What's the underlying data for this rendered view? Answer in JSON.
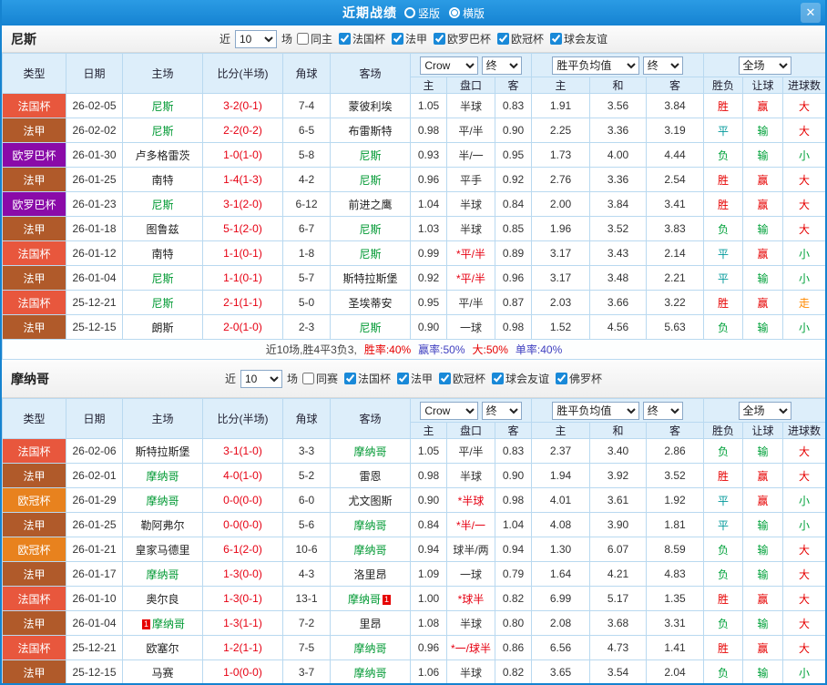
{
  "window": {
    "title": "近期战绩",
    "close_icon": "✕",
    "layout_options": [
      {
        "name": "vertical",
        "label": "竖版",
        "selected": false
      },
      {
        "name": "horizontal",
        "label": "横版",
        "selected": true
      }
    ]
  },
  "controls": {
    "near_label": "近",
    "match_count": "10",
    "games_label": "场",
    "bookmaker": "Crow",
    "final_label": "终",
    "avg_label": "胜平负均值",
    "scope_label": "全场"
  },
  "columns": {
    "type": "类型",
    "date": "日期",
    "home": "主场",
    "score": "比分(半场)",
    "corner": "角球",
    "away": "客场",
    "asian_home": "主",
    "asian_line": "盘口",
    "asian_away": "客",
    "avg_home": "主",
    "avg_draw": "和",
    "avg_away": "客",
    "wdl": "胜负",
    "handicap": "让球",
    "goals": "进球数"
  },
  "colors": {
    "accent_blue": "#1989d8",
    "focus_team_green": "#009933",
    "score_red": "#e60012",
    "types": {
      "法国杯": "#e8573d",
      "法甲": "#b05a2a",
      "欧罗巴杯": "#8a0ba8",
      "欧冠杯": "#e8821e"
    },
    "results": {
      "胜": "#e60000",
      "平": "#00999b",
      "负": "#00a13a",
      "赢": "#e60000",
      "输": "#00a13a",
      "大": "#e60000",
      "小": "#00a13a",
      "走": "#ff8a00"
    }
  },
  "sections": [
    {
      "team": "尼斯",
      "filters": [
        {
          "label": "同主",
          "checked": false
        },
        {
          "label": "法国杯",
          "checked": true
        },
        {
          "label": "法甲",
          "checked": true
        },
        {
          "label": "欧罗巴杯",
          "checked": true
        },
        {
          "label": "欧冠杯",
          "checked": true
        },
        {
          "label": "球会友谊",
          "checked": true
        }
      ],
      "rows": [
        {
          "type": "法国杯",
          "date": "26-02-05",
          "home": "尼斯",
          "home_focus": true,
          "score": "3-2(0-1)",
          "corner": "7-4",
          "away": "蒙彼利埃",
          "away_focus": false,
          "o1": "1.05",
          "line": "半球",
          "o2": "0.83",
          "e1": "1.91",
          "e2": "3.56",
          "e3": "3.84",
          "r1": "胜",
          "r2": "赢",
          "r3": "大"
        },
        {
          "type": "法甲",
          "date": "26-02-02",
          "home": "尼斯",
          "home_focus": true,
          "score": "2-2(0-2)",
          "corner": "6-5",
          "away": "布雷斯特",
          "away_focus": false,
          "o1": "0.98",
          "line": "平/半",
          "o2": "0.90",
          "e1": "2.25",
          "e2": "3.36",
          "e3": "3.19",
          "r1": "平",
          "r2": "输",
          "r3": "大"
        },
        {
          "type": "欧罗巴杯",
          "date": "26-01-30",
          "home": "卢多格雷茨",
          "home_focus": false,
          "score": "1-0(1-0)",
          "corner": "5-8",
          "away": "尼斯",
          "away_focus": true,
          "o1": "0.93",
          "line": "半/一",
          "o2": "0.95",
          "e1": "1.73",
          "e2": "4.00",
          "e3": "4.44",
          "r1": "负",
          "r2": "输",
          "r3": "小"
        },
        {
          "type": "法甲",
          "date": "26-01-25",
          "home": "南特",
          "home_focus": false,
          "score": "1-4(1-3)",
          "corner": "4-2",
          "away": "尼斯",
          "away_focus": true,
          "o1": "0.96",
          "line": "平手",
          "o2": "0.92",
          "e1": "2.76",
          "e2": "3.36",
          "e3": "2.54",
          "r1": "胜",
          "r2": "赢",
          "r3": "大"
        },
        {
          "type": "欧罗巴杯",
          "date": "26-01-23",
          "home": "尼斯",
          "home_focus": true,
          "score": "3-1(2-0)",
          "corner": "6-12",
          "away": "前进之鹰",
          "away_focus": false,
          "o1": "1.04",
          "line": "半球",
          "o2": "0.84",
          "e1": "2.00",
          "e2": "3.84",
          "e3": "3.41",
          "r1": "胜",
          "r2": "赢",
          "r3": "大"
        },
        {
          "type": "法甲",
          "date": "26-01-18",
          "home": "图鲁兹",
          "home_focus": false,
          "score": "5-1(2-0)",
          "corner": "6-7",
          "away": "尼斯",
          "away_focus": true,
          "o1": "1.03",
          "line": "半球",
          "o2": "0.85",
          "e1": "1.96",
          "e2": "3.52",
          "e3": "3.83",
          "r1": "负",
          "r2": "输",
          "r3": "大"
        },
        {
          "type": "法国杯",
          "date": "26-01-12",
          "home": "南特",
          "home_focus": false,
          "score": "1-1(0-1)",
          "corner": "1-8",
          "away": "尼斯",
          "away_focus": true,
          "o1": "0.99",
          "line": "*平/半",
          "o2": "0.89",
          "e1": "3.17",
          "e2": "3.43",
          "e3": "2.14",
          "r1": "平",
          "r2": "赢",
          "r3": "小"
        },
        {
          "type": "法甲",
          "date": "26-01-04",
          "home": "尼斯",
          "home_focus": true,
          "score": "1-1(0-1)",
          "corner": "5-7",
          "away": "斯特拉斯堡",
          "away_focus": false,
          "o1": "0.92",
          "line": "*平/半",
          "o2": "0.96",
          "e1": "3.17",
          "e2": "3.48",
          "e3": "2.21",
          "r1": "平",
          "r2": "输",
          "r3": "小"
        },
        {
          "type": "法国杯",
          "date": "25-12-21",
          "home": "尼斯",
          "home_focus": true,
          "score": "2-1(1-1)",
          "corner": "5-0",
          "away": "圣埃蒂安",
          "away_focus": false,
          "o1": "0.95",
          "line": "平/半",
          "o2": "0.87",
          "e1": "2.03",
          "e2": "3.66",
          "e3": "3.22",
          "r1": "胜",
          "r2": "赢",
          "r3": "走"
        },
        {
          "type": "法甲",
          "date": "25-12-15",
          "home": "朗斯",
          "home_focus": false,
          "score": "2-0(1-0)",
          "corner": "2-3",
          "away": "尼斯",
          "away_focus": true,
          "o1": "0.90",
          "line": "一球",
          "o2": "0.98",
          "e1": "1.52",
          "e2": "4.56",
          "e3": "5.63",
          "r1": "负",
          "r2": "输",
          "r3": "小"
        }
      ],
      "summary": [
        {
          "text": "近10场,胜4平3负3,",
          "color": "#444444"
        },
        {
          "text": "胜率:40%",
          "color": "#e60000"
        },
        {
          "text": "赢率:50%",
          "color": "#4040c0"
        },
        {
          "text": "大:50%",
          "color": "#e60000"
        },
        {
          "text": "单率:40%",
          "color": "#4040c0"
        }
      ]
    },
    {
      "team": "摩纳哥",
      "filters": [
        {
          "label": "同赛",
          "checked": false
        },
        {
          "label": "法国杯",
          "checked": true
        },
        {
          "label": "法甲",
          "checked": true
        },
        {
          "label": "欧冠杯",
          "checked": true
        },
        {
          "label": "球会友谊",
          "checked": true
        },
        {
          "label": "佛罗杯",
          "checked": true
        }
      ],
      "rows": [
        {
          "type": "法国杯",
          "date": "26-02-06",
          "home": "斯特拉斯堡",
          "home_focus": false,
          "score": "3-1(1-0)",
          "corner": "3-3",
          "away": "摩纳哥",
          "away_focus": true,
          "o1": "1.05",
          "line": "平/半",
          "o2": "0.83",
          "e1": "2.37",
          "e2": "3.40",
          "e3": "2.86",
          "r1": "负",
          "r2": "输",
          "r3": "大"
        },
        {
          "type": "法甲",
          "date": "26-02-01",
          "home": "摩纳哥",
          "home_focus": true,
          "score": "4-0(1-0)",
          "corner": "5-2",
          "away": "雷恩",
          "away_focus": false,
          "o1": "0.98",
          "line": "半球",
          "o2": "0.90",
          "e1": "1.94",
          "e2": "3.92",
          "e3": "3.52",
          "r1": "胜",
          "r2": "赢",
          "r3": "大"
        },
        {
          "type": "欧冠杯",
          "date": "26-01-29",
          "home": "摩纳哥",
          "home_focus": true,
          "score": "0-0(0-0)",
          "corner": "6-0",
          "away": "尤文图斯",
          "away_focus": false,
          "o1": "0.90",
          "line": "*半球",
          "o2": "0.98",
          "e1": "4.01",
          "e2": "3.61",
          "e3": "1.92",
          "r1": "平",
          "r2": "赢",
          "r3": "小"
        },
        {
          "type": "法甲",
          "date": "26-01-25",
          "home": "勒阿弗尔",
          "home_focus": false,
          "score": "0-0(0-0)",
          "corner": "5-6",
          "away": "摩纳哥",
          "away_focus": true,
          "o1": "0.84",
          "line": "*半/一",
          "o2": "1.04",
          "e1": "4.08",
          "e2": "3.90",
          "e3": "1.81",
          "r1": "平",
          "r2": "输",
          "r3": "小"
        },
        {
          "type": "欧冠杯",
          "date": "26-01-21",
          "home": "皇家马德里",
          "home_focus": false,
          "score": "6-1(2-0)",
          "corner": "10-6",
          "away": "摩纳哥",
          "away_focus": true,
          "o1": "0.94",
          "line": "球半/两",
          "o2": "0.94",
          "e1": "1.30",
          "e2": "6.07",
          "e3": "8.59",
          "r1": "负",
          "r2": "输",
          "r3": "大"
        },
        {
          "type": "法甲",
          "date": "26-01-17",
          "home": "摩纳哥",
          "home_focus": true,
          "score": "1-3(0-0)",
          "corner": "4-3",
          "away": "洛里昂",
          "away_focus": false,
          "o1": "1.09",
          "line": "一球",
          "o2": "0.79",
          "e1": "1.64",
          "e2": "4.21",
          "e3": "4.83",
          "r1": "负",
          "r2": "输",
          "r3": "大"
        },
        {
          "type": "法国杯",
          "date": "26-01-10",
          "home": "奥尔良",
          "home_focus": false,
          "score": "1-3(0-1)",
          "corner": "13-1",
          "away": "摩纳哥",
          "away_focus": true,
          "away_card": {
            "position": "after",
            "label": "1"
          },
          "o1": "1.00",
          "line": "*球半",
          "o2": "0.82",
          "e1": "6.99",
          "e2": "5.17",
          "e3": "1.35",
          "r1": "胜",
          "r2": "赢",
          "r3": "大"
        },
        {
          "type": "法甲",
          "date": "26-01-04",
          "home": "摩纳哥",
          "home_focus": true,
          "home_card": {
            "position": "before",
            "label": "1"
          },
          "score": "1-3(1-1)",
          "corner": "7-2",
          "away": "里昂",
          "away_focus": false,
          "o1": "1.08",
          "line": "半球",
          "o2": "0.80",
          "e1": "2.08",
          "e2": "3.68",
          "e3": "3.31",
          "r1": "负",
          "r2": "输",
          "r3": "大"
        },
        {
          "type": "法国杯",
          "date": "25-12-21",
          "home": "欧塞尔",
          "home_focus": false,
          "score": "1-2(1-1)",
          "corner": "7-5",
          "away": "摩纳哥",
          "away_focus": true,
          "o1": "0.96",
          "line": "*一/球半",
          "o2": "0.86",
          "e1": "6.56",
          "e2": "4.73",
          "e3": "1.41",
          "r1": "胜",
          "r2": "赢",
          "r3": "大"
        },
        {
          "type": "法甲",
          "date": "25-12-15",
          "home": "马赛",
          "home_focus": false,
          "score": "1-0(0-0)",
          "corner": "3-7",
          "away": "摩纳哥",
          "away_focus": true,
          "o1": "1.06",
          "line": "半球",
          "o2": "0.82",
          "e1": "3.65",
          "e2": "3.54",
          "e3": "2.04",
          "r1": "负",
          "r2": "输",
          "r3": "小"
        }
      ]
    }
  ]
}
